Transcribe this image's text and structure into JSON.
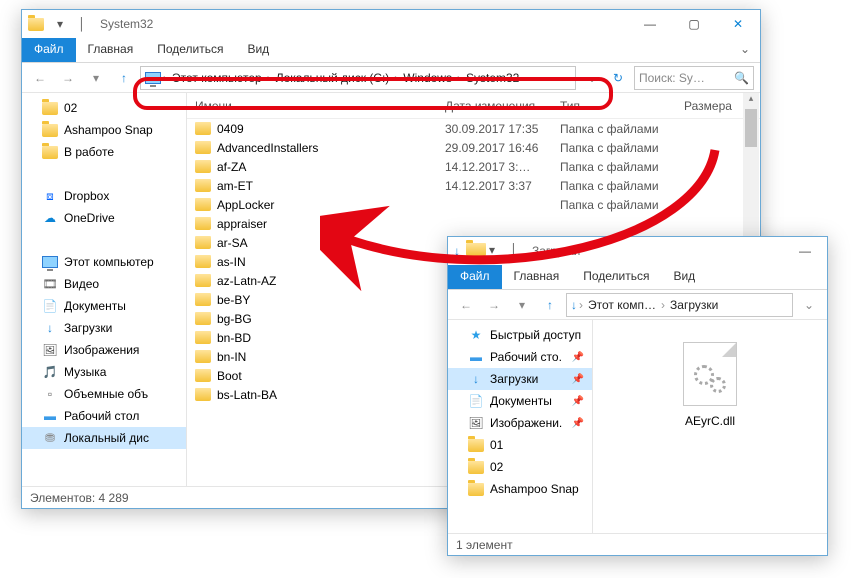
{
  "win1": {
    "title": "System32",
    "tabs": {
      "file": "Файл",
      "home": "Главная",
      "share": "Поделиться",
      "view": "Вид"
    },
    "breadcrumb": [
      "Этот компьютер",
      "Локальный диск (C:)",
      "Windows",
      "System32"
    ],
    "refresh_hint": "↻",
    "search_placeholder": "Поиск: Sy…",
    "columns": {
      "name": "Имени",
      "date": "Дата изменения",
      "type": "Тип",
      "size": "Размера"
    },
    "nav": [
      {
        "label": "02",
        "icon": "folder"
      },
      {
        "label": "Ashampoo Snap",
        "icon": "folder"
      },
      {
        "label": "В работе",
        "icon": "folder"
      },
      {
        "label": "",
        "icon": "blank"
      },
      {
        "label": "Dropbox",
        "icon": "dropbox"
      },
      {
        "label": "OneDrive",
        "icon": "onedrive"
      },
      {
        "label": "",
        "icon": "blank"
      },
      {
        "label": "Этот компьютер",
        "icon": "monitor"
      },
      {
        "label": "Видео",
        "icon": "video"
      },
      {
        "label": "Документы",
        "icon": "doc"
      },
      {
        "label": "Загрузки",
        "icon": "download"
      },
      {
        "label": "Изображения",
        "icon": "image"
      },
      {
        "label": "Музыка",
        "icon": "music"
      },
      {
        "label": "Объемные объ",
        "icon": "cube"
      },
      {
        "label": "Рабочий стол",
        "icon": "desktop"
      },
      {
        "label": "Локальный дис",
        "icon": "disk",
        "selected": true
      }
    ],
    "rows": [
      {
        "name": "0409",
        "date": "30.09.2017 17:35",
        "type": "Папка с файлами"
      },
      {
        "name": "AdvancedInstallers",
        "date": "29.09.2017 16:46",
        "type": "Папка с файлами"
      },
      {
        "name": "af-ZA",
        "date": "14.12.2017 3:…",
        "type": "Папка с файлами"
      },
      {
        "name": "am-ET",
        "date": "14.12.2017 3:37",
        "type": "Папка с файлами"
      },
      {
        "name": "AppLocker",
        "date": "",
        "type": "Папка с файлами"
      },
      {
        "name": "appraiser",
        "date": "",
        "type": ""
      },
      {
        "name": "ar-SA",
        "date": "",
        "type": ""
      },
      {
        "name": "as-IN",
        "date": "",
        "type": ""
      },
      {
        "name": "az-Latn-AZ",
        "date": "",
        "type": ""
      },
      {
        "name": "be-BY",
        "date": "",
        "type": ""
      },
      {
        "name": "bg-BG",
        "date": "",
        "type": ""
      },
      {
        "name": "bn-BD",
        "date": "",
        "type": ""
      },
      {
        "name": "bn-IN",
        "date": "",
        "type": ""
      },
      {
        "name": "Boot",
        "date": "",
        "type": ""
      },
      {
        "name": "bs-Latn-BA",
        "date": "",
        "type": ""
      }
    ],
    "status": "Элементов: 4 289"
  },
  "win2": {
    "title": "Загрузки",
    "tabs": {
      "file": "Файл",
      "home": "Главная",
      "share": "Поделиться",
      "view": "Вид"
    },
    "breadcrumb": [
      "Этот комп…",
      "Загрузки"
    ],
    "nav": [
      {
        "label": "Быстрый доступ",
        "icon": "star"
      },
      {
        "label": "Рабочий сто.",
        "icon": "desktop",
        "pin": true
      },
      {
        "label": "Загрузки",
        "icon": "download",
        "pin": true,
        "selected": true
      },
      {
        "label": "Документы",
        "icon": "doc",
        "pin": true
      },
      {
        "label": "Изображени.",
        "icon": "image",
        "pin": true
      },
      {
        "label": "01",
        "icon": "folder"
      },
      {
        "label": "02",
        "icon": "folder"
      },
      {
        "label": "Ashampoo Snap",
        "icon": "folder"
      }
    ],
    "file": {
      "name": "AEyrC.dll"
    },
    "status": "1 элемент"
  }
}
